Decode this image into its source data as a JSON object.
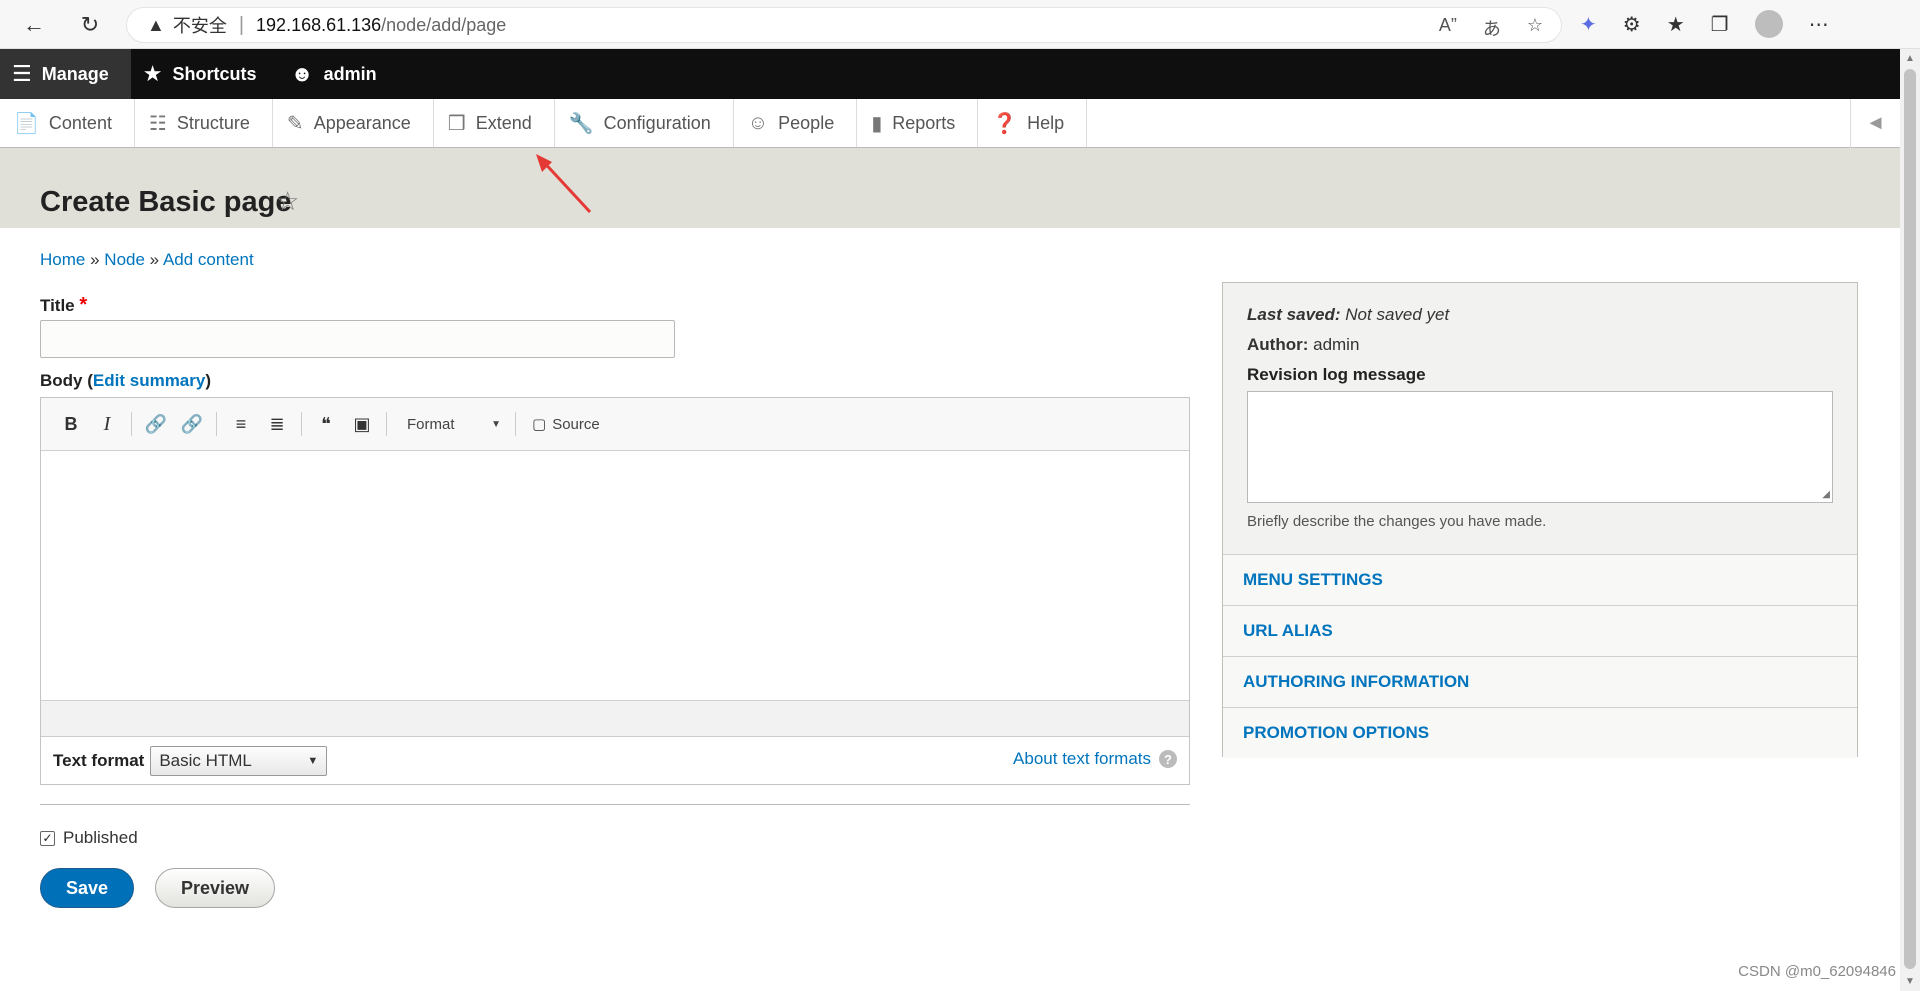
{
  "browser": {
    "warning_icon": "warning-icon",
    "insecure_label": "不安全",
    "url_host": "192.168.61.136",
    "url_path": "/node/add/page"
  },
  "toolbar": {
    "manage": "Manage",
    "shortcuts": "Shortcuts",
    "user": "admin"
  },
  "tray": [
    {
      "label": "Content",
      "icon": "file-icon"
    },
    {
      "label": "Structure",
      "icon": "sitemap-icon"
    },
    {
      "label": "Appearance",
      "icon": "paintbrush-icon"
    },
    {
      "label": "Extend",
      "icon": "puzzle-icon"
    },
    {
      "label": "Configuration",
      "icon": "wrench-icon"
    },
    {
      "label": "People",
      "icon": "people-icon"
    },
    {
      "label": "Reports",
      "icon": "bar-chart-icon"
    },
    {
      "label": "Help",
      "icon": "help-icon"
    }
  ],
  "page": {
    "title": "Create Basic page"
  },
  "breadcrumb": {
    "home": "Home",
    "node": "Node",
    "add_content": "Add content",
    "sep": "»"
  },
  "form": {
    "title_label": "Title",
    "required_mark": "*",
    "body_label": "Body",
    "edit_summary": "Edit summary",
    "editor": {
      "format_label": "Format",
      "source_label": "Source"
    },
    "text_format_label": "Text format",
    "text_format_value": "Basic HTML",
    "about_text_formats": "About text formats",
    "published_label": "Published",
    "published_checked": true,
    "save": "Save",
    "preview": "Preview"
  },
  "sidebar": {
    "last_saved_label": "Last saved:",
    "last_saved_value": "Not saved yet",
    "author_label": "Author:",
    "author_value": "admin",
    "revision_label": "Revision log message",
    "revision_desc": "Briefly describe the changes you have made.",
    "sections": [
      "MENU SETTINGS",
      "URL ALIAS",
      "AUTHORING INFORMATION",
      "PROMOTION OPTIONS"
    ]
  },
  "watermark": "CSDN @m0_62094846",
  "colors": {
    "link": "#0074bd",
    "toolbar_bg": "#0f0f0f",
    "save_bg": "#0071b8",
    "annotation_arrow": "#e53935"
  }
}
